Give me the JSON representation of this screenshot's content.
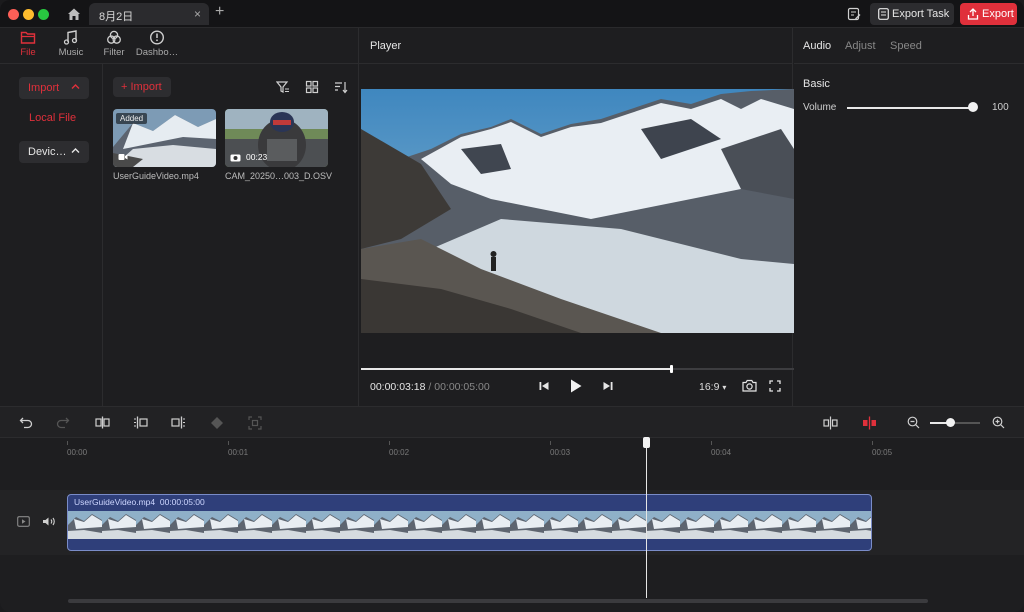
{
  "titlebar": {
    "tab_label": "8月2日",
    "close": "×",
    "new_tab": "+",
    "export_task_label": "Export Task",
    "export_label": "Export"
  },
  "nav": [
    {
      "label": "File",
      "icon": "folder-icon",
      "active": true
    },
    {
      "label": "Music",
      "icon": "music-note-icon",
      "active": false
    },
    {
      "label": "Filter",
      "icon": "filter-circles-icon",
      "active": false
    },
    {
      "label": "Dashbo…",
      "icon": "dashboard-gauge-icon",
      "active": false
    }
  ],
  "sidebar": {
    "import_label": "Import",
    "local_file_label": "Local File",
    "device_label": "Devic…"
  },
  "media": {
    "import_label": "Import",
    "items": [
      {
        "name": "UserGuideVideo.mp4",
        "badge": "Added",
        "duration": ""
      },
      {
        "name": "CAM_20250…003_D.OSV",
        "badge": "",
        "duration": "00:23"
      }
    ]
  },
  "player": {
    "title": "Player",
    "current_time": "00:00:03:18",
    "total_time": "/ 00:00:05:00",
    "aspect": "16:9",
    "progress": 0.714
  },
  "right_panel": {
    "tabs": [
      {
        "label": "Audio",
        "active": true
      },
      {
        "label": "Adjust",
        "active": false
      },
      {
        "label": "Speed",
        "active": false
      }
    ],
    "section": "Basic",
    "volume_label": "Volume",
    "volume_value": "100"
  },
  "timeline": {
    "ticks": [
      "00:00",
      "00:01",
      "00:02",
      "00:03",
      "00:04",
      "00:05"
    ],
    "clip_name": "UserGuideVideo.mp4",
    "clip_duration": "00:00:05:00",
    "playhead_time": "00:00:03:18"
  },
  "colors": {
    "accent": "#e0303b",
    "clip": "#2f3f7a",
    "background": "#1e1e20"
  }
}
